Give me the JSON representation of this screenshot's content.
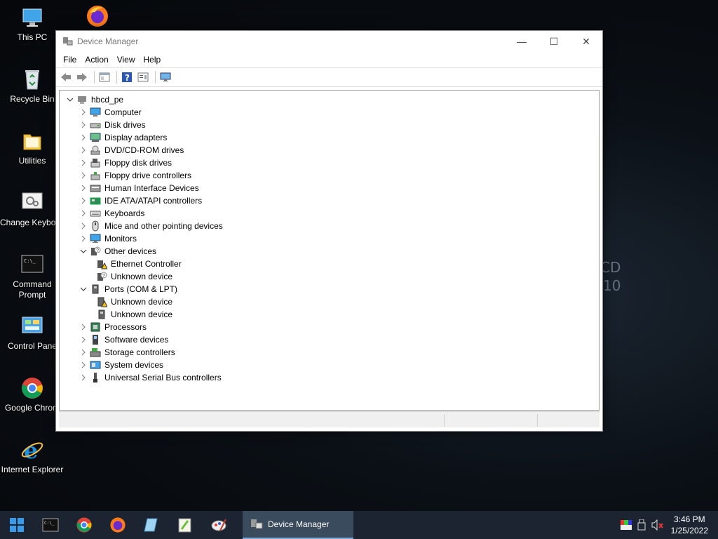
{
  "desktop": {
    "wallpaper_text": [
      "CD",
      "10"
    ],
    "icons": [
      {
        "label": "This PC",
        "icon": "this-pc-icon"
      },
      {
        "label": "",
        "icon": "firefox-icon"
      },
      {
        "label": "Recycle Bin",
        "icon": "recycle-bin-icon"
      },
      {
        "label": "Utilities",
        "icon": "folder-icon"
      },
      {
        "label": "Change Keyboard Layo",
        "icon": "keyboard-layout-icon"
      },
      {
        "label": "Command Prompt",
        "icon": "command-prompt-icon"
      },
      {
        "label": "Control Pane",
        "icon": "control-panel-icon"
      },
      {
        "label": "Google Chrom",
        "icon": "chrome-icon"
      },
      {
        "label": "Internet Explorer",
        "icon": "internet-explorer-icon"
      }
    ]
  },
  "window": {
    "title": "Device Manager",
    "controls": {
      "minimize": "—",
      "maximize": "☐",
      "close": "✕"
    },
    "menu": [
      "File",
      "Action",
      "View",
      "Help"
    ],
    "toolbar": [
      "back-icon",
      "forward-icon",
      "properties-pane-icon",
      "help-icon",
      "properties-icon",
      "scan-hardware-icon"
    ],
    "tree": [
      {
        "label": "hbcd_pe",
        "level": 0,
        "expander": "open",
        "icon": "computer-root-icon"
      },
      {
        "label": "Computer",
        "level": 1,
        "expander": "closed",
        "icon": "computer-icon"
      },
      {
        "label": "Disk drives",
        "level": 1,
        "expander": "closed",
        "icon": "disk-drive-icon"
      },
      {
        "label": "Display adapters",
        "level": 1,
        "expander": "closed",
        "icon": "display-adapter-icon"
      },
      {
        "label": "DVD/CD-ROM drives",
        "level": 1,
        "expander": "closed",
        "icon": "dvd-icon"
      },
      {
        "label": "Floppy disk drives",
        "level": 1,
        "expander": "closed",
        "icon": "floppy-disk-icon"
      },
      {
        "label": "Floppy drive controllers",
        "level": 1,
        "expander": "closed",
        "icon": "floppy-controller-icon"
      },
      {
        "label": "Human Interface Devices",
        "level": 1,
        "expander": "closed",
        "icon": "hid-icon"
      },
      {
        "label": "IDE ATA/ATAPI controllers",
        "level": 1,
        "expander": "closed",
        "icon": "ide-controller-icon"
      },
      {
        "label": "Keyboards",
        "level": 1,
        "expander": "closed",
        "icon": "keyboard-icon"
      },
      {
        "label": "Mice and other pointing devices",
        "level": 1,
        "expander": "closed",
        "icon": "mouse-icon"
      },
      {
        "label": "Monitors",
        "level": 1,
        "expander": "closed",
        "icon": "monitor-icon"
      },
      {
        "label": "Other devices",
        "level": 1,
        "expander": "open",
        "icon": "other-devices-icon"
      },
      {
        "label": "Ethernet Controller",
        "level": 2,
        "expander": "none",
        "icon": "warning-device-icon"
      },
      {
        "label": "Unknown device",
        "level": 2,
        "expander": "none",
        "icon": "unknown-device-icon"
      },
      {
        "label": "Ports (COM & LPT)",
        "level": 1,
        "expander": "open",
        "icon": "port-icon"
      },
      {
        "label": "Unknown device",
        "level": 2,
        "expander": "none",
        "icon": "warning-port-icon"
      },
      {
        "label": "Unknown device",
        "level": 2,
        "expander": "none",
        "icon": "port-device-icon"
      },
      {
        "label": "Processors",
        "level": 1,
        "expander": "closed",
        "icon": "processor-icon"
      },
      {
        "label": "Software devices",
        "level": 1,
        "expander": "closed",
        "icon": "software-device-icon"
      },
      {
        "label": "Storage controllers",
        "level": 1,
        "expander": "closed",
        "icon": "storage-controller-icon"
      },
      {
        "label": "System devices",
        "level": 1,
        "expander": "closed",
        "icon": "system-device-icon"
      },
      {
        "label": "Universal Serial Bus controllers",
        "level": 1,
        "expander": "closed",
        "icon": "usb-icon"
      }
    ],
    "status_panels": [
      "",
      "",
      ""
    ]
  },
  "taskbar": {
    "pinned": [
      "start-icon",
      "command-prompt-icon",
      "chrome-icon",
      "firefox-icon",
      "notepad-icon",
      "notepadpp-icon",
      "paint-icon"
    ],
    "active_app": {
      "label": "Device Manager",
      "icon": "device-manager-icon"
    },
    "tray_icons": [
      "color-icon",
      "usb-eject-icon",
      "volume-muted-icon"
    ],
    "time": "3:46 PM",
    "date": "1/25/2022"
  },
  "colors": {
    "taskbar": "#1b2430",
    "accent": "#7aa9d8",
    "warning": "#f2c10f"
  }
}
